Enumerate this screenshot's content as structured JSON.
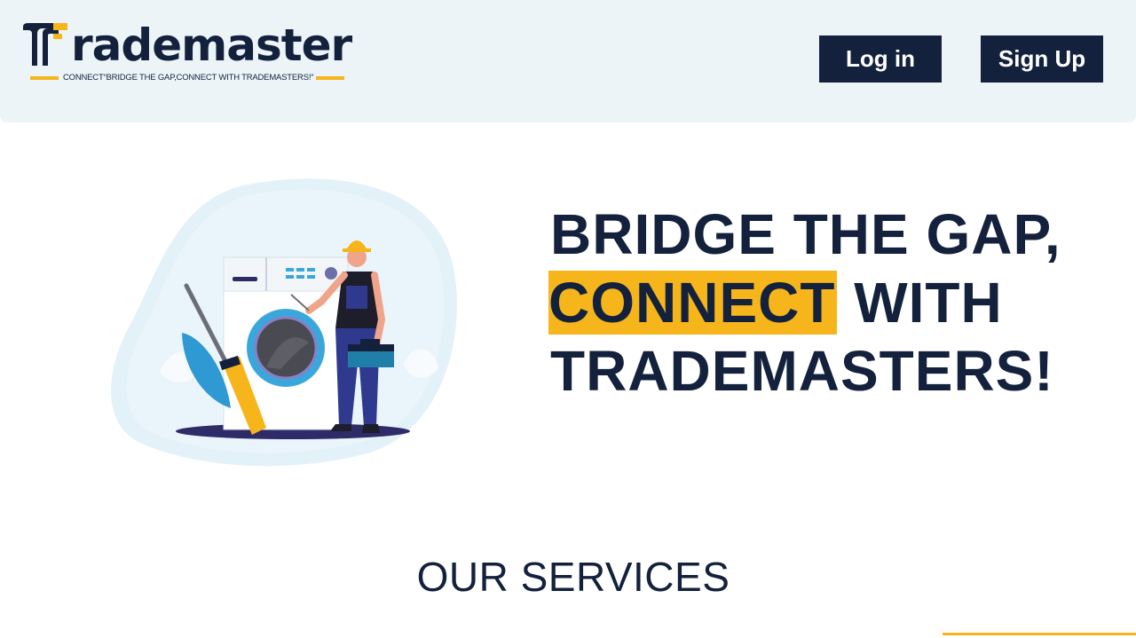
{
  "header": {
    "logo_word": "rademaster",
    "tagline": "CONNECT“BRIDGE THE GAP,CONNECT WITH TRADEMASTERS!”",
    "login_label": "Log in",
    "signup_label": "Sign Up"
  },
  "hero": {
    "line1": "BRIDGE THE GAP,",
    "highlight": "CONNECT",
    "line2_rest": " WITH",
    "line3": "TRADEMASTERS!"
  },
  "services": {
    "title": "OUR SERVICES"
  },
  "colors": {
    "navy": "#14213d",
    "accent": "#f5b51b",
    "header_bg": "#ecf4f8"
  },
  "icons": [
    "logo-t-mark-icon",
    "repairman-washing-machine-illustration"
  ]
}
